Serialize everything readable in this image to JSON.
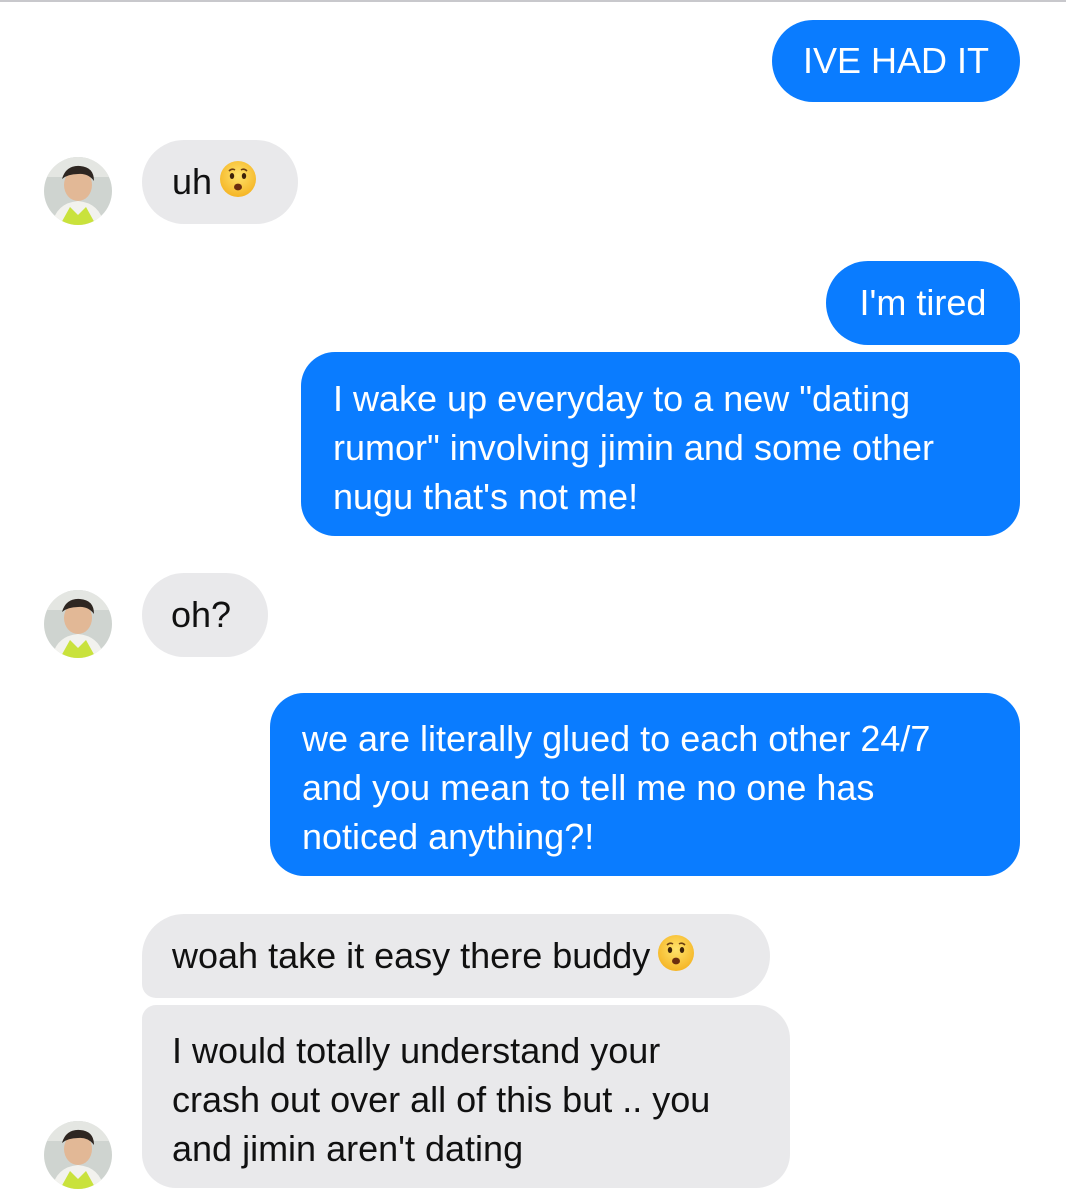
{
  "conversation": {
    "messages": [
      {
        "sender": "me",
        "lines": [
          "IVE HAD IT"
        ]
      },
      {
        "sender": "them",
        "lines": [
          "uh"
        ],
        "emoji": "anxious-face-icon"
      },
      {
        "sender": "me",
        "lines": [
          "I'm tired"
        ]
      },
      {
        "sender": "me",
        "lines": [
          "I wake up everyday to a new \"dating",
          "rumor\" involving jimin and some other",
          "nugu that's not me!"
        ]
      },
      {
        "sender": "them",
        "lines": [
          "oh?"
        ]
      },
      {
        "sender": "me",
        "lines": [
          "we are literally glued to each other 24/7",
          "and you mean to tell me no one has",
          "noticed anything?!"
        ]
      },
      {
        "sender": "them",
        "lines": [
          "woah take it easy there buddy"
        ],
        "emoji": "anxious-face-icon"
      },
      {
        "sender": "them",
        "lines": [
          "I would totally understand your",
          "crash out over all of this but .. you",
          "and jimin aren't dating"
        ]
      }
    ]
  },
  "colors": {
    "sent_bubble": "#0a7cff",
    "received_bubble": "#e9e9eb",
    "background": "#ffffff"
  }
}
